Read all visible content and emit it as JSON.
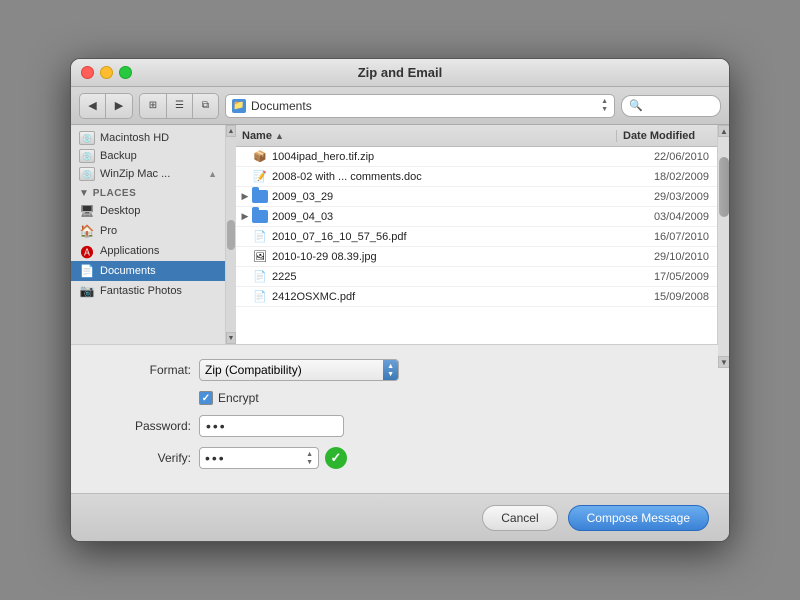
{
  "window": {
    "title": "Zip and Email"
  },
  "toolbar": {
    "location": "Documents",
    "search_placeholder": "Search"
  },
  "sidebar": {
    "devices": [
      {
        "label": "Macintosh HD"
      },
      {
        "label": "Backup"
      },
      {
        "label": "WinZip Mac ..."
      }
    ],
    "section_label": "PLACES",
    "places": [
      {
        "label": "Desktop",
        "icon": "🖥"
      },
      {
        "label": "Pro",
        "icon": "🏠"
      },
      {
        "label": "Applications",
        "icon": "🅐"
      },
      {
        "label": "Documents",
        "icon": "📄",
        "selected": true
      },
      {
        "label": "Fantastic Photos",
        "icon": "📷"
      }
    ]
  },
  "file_list": {
    "col_name": "Name",
    "col_date": "Date Modified",
    "files": [
      {
        "name": "1004ipad_hero.tif.zip",
        "date": "22/06/2010",
        "type": "zip",
        "expand": false
      },
      {
        "name": "2008-02 with ... comments.doc",
        "date": "18/02/2009",
        "type": "doc",
        "expand": false
      },
      {
        "name": "2009_03_29",
        "date": "29/03/2009",
        "type": "folder",
        "expand": true
      },
      {
        "name": "2009_04_03",
        "date": "03/04/2009",
        "type": "folder",
        "expand": true
      },
      {
        "name": "2010_07_16_10_57_56.pdf",
        "date": "16/07/2010",
        "type": "pdf",
        "expand": false
      },
      {
        "name": "2010-10-29 08.39.jpg",
        "date": "29/10/2010",
        "type": "jpg",
        "expand": false
      },
      {
        "name": "2225",
        "date": "17/05/2009",
        "type": "file",
        "expand": false
      },
      {
        "name": "2412OSXMC.pdf",
        "date": "15/09/2008",
        "type": "pdf",
        "expand": false
      }
    ]
  },
  "bottom_panel": {
    "format_label": "Format:",
    "format_value": "Zip (Compatibility)",
    "encrypt_label": "Encrypt",
    "password_label": "Password:",
    "password_value": "•••",
    "verify_label": "Verify:",
    "verify_value": "•••"
  },
  "buttons": {
    "cancel": "Cancel",
    "compose": "Compose Message"
  }
}
